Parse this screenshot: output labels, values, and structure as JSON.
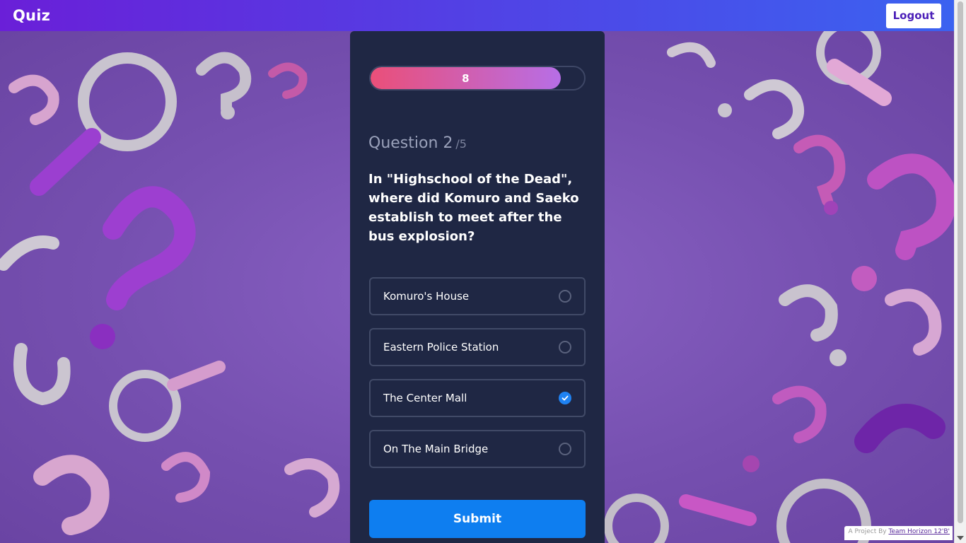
{
  "header": {
    "brand": "Quiz",
    "logout_label": "Logout"
  },
  "quiz": {
    "timer_value": "8",
    "timer_fraction": 0.89,
    "question_label": "Question 2",
    "question_total": "/5",
    "question_text": "In \"Highschool of the Dead\", where did Komuro and Saeko establish to meet after the bus explosion?",
    "options": [
      {
        "label": "Komuro's House",
        "selected": false
      },
      {
        "label": "Eastern Police Station",
        "selected": false
      },
      {
        "label": "The Center Mall",
        "selected": true
      },
      {
        "label": "On The Main Bridge",
        "selected": false
      }
    ],
    "submit_label": "Submit"
  },
  "footer": {
    "credit_prefix": "A Project By",
    "credit_link": "Team Horizon 12'B'"
  },
  "colors": {
    "accent": "#0e7ef0",
    "card_bg": "#1f2744",
    "header_start": "#6a1fd8",
    "header_end": "#3b62f0"
  }
}
